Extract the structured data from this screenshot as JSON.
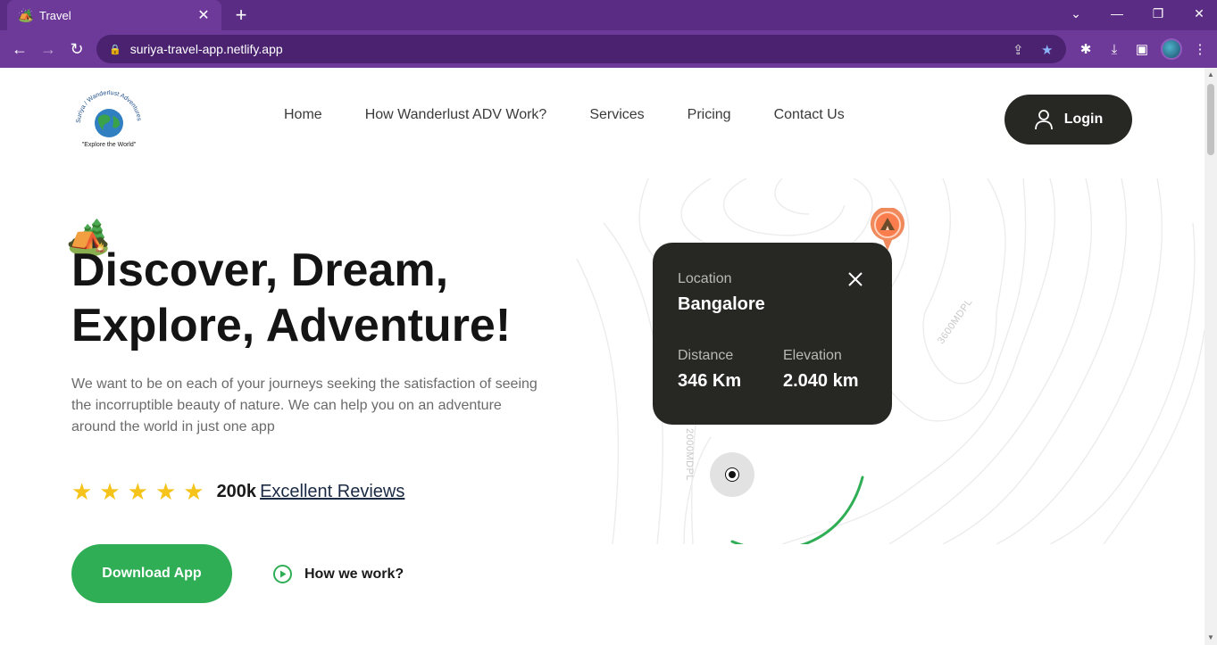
{
  "browser": {
    "tab_title": "Travel",
    "tab_favicon": "🏕️",
    "url": "suriya-travel-app.netlify.app"
  },
  "nav": {
    "items": [
      "Home",
      "How Wanderlust ADV Work?",
      "Services",
      "Pricing",
      "Contact Us"
    ],
    "login_label": "Login"
  },
  "logo": {
    "arc_text": "Suriya / Wanderlust Adventures",
    "tagline": "\"Explore the World\""
  },
  "hero": {
    "headline_line1": "Discover, Dream,",
    "headline_line2": "Explore, Adventure!",
    "description": "We want to be on each of your journeys seeking the satisfaction of seeing the incorruptible beauty of nature. We can help you on an adventure around the world in just one app",
    "rating_stars": 5,
    "review_count": "200k",
    "review_label": "Excellent Reviews",
    "download_label": "Download App",
    "how_label": "How we work?"
  },
  "map": {
    "location_label": "Location",
    "location_value": "Bangalore",
    "distance_label": "Distance",
    "distance_value": "346 Km",
    "elevation_label": "Elevation",
    "elevation_value": "2.040 km",
    "contour_label_1": "3600MDPL",
    "contour_label_2": "2000MDPL"
  },
  "colors": {
    "chrome": "#6e3a99",
    "accent_green": "#2fae55",
    "dark": "#272824",
    "star": "#f6c31a",
    "pin": "#f08a5d"
  }
}
